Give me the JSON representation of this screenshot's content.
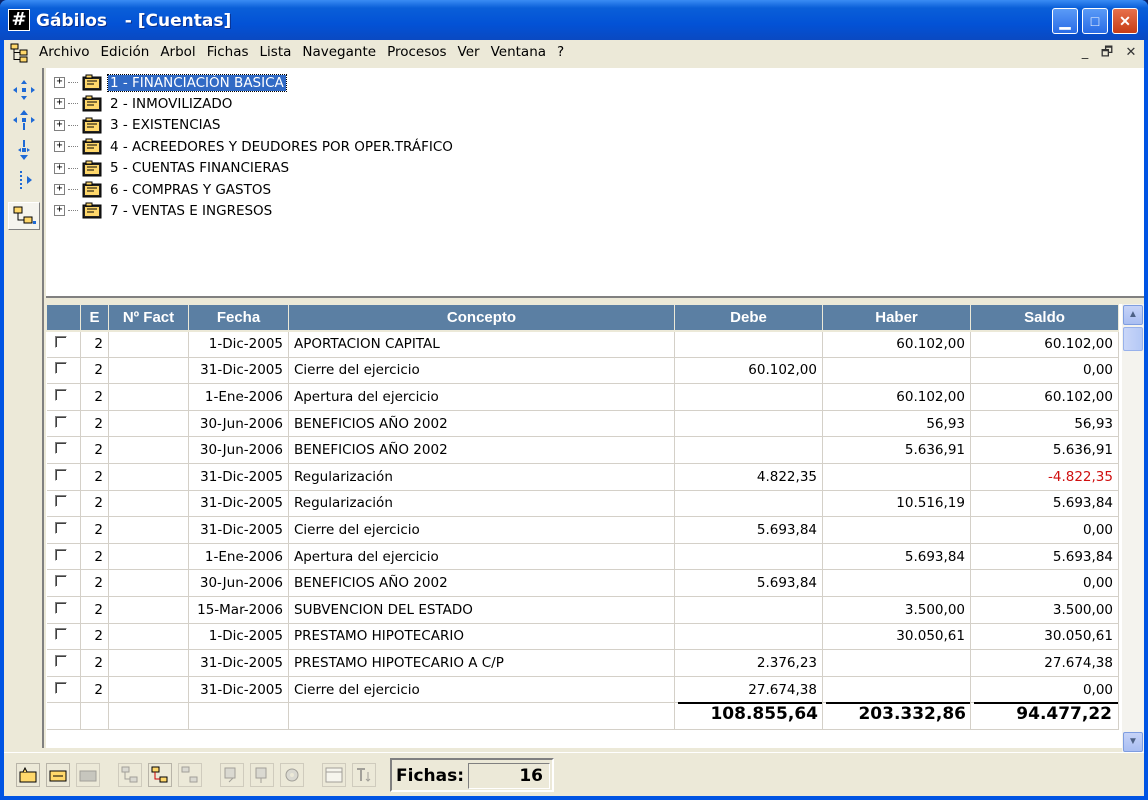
{
  "window": {
    "app_name": "Gábilos",
    "doc_title": " - [Cuentas]",
    "app_icon_glyph": "#",
    "minimize_glyph": "▁",
    "maximize_glyph": "□",
    "close_glyph": "✕"
  },
  "menu": {
    "items": [
      "Archivo",
      "Edición",
      "Arbol",
      "Fichas",
      "Lista",
      "Navegante",
      "Procesos",
      "Ver",
      "Ventana",
      "?"
    ],
    "mdi_minimize": "_",
    "mdi_restore": "🗗",
    "mdi_close": "✕"
  },
  "tree": {
    "expander": "+",
    "items": [
      {
        "label": "1 - FINANCIACIÓN BASICA",
        "selected": true
      },
      {
        "label": "2 - INMOVILIZADO",
        "selected": false
      },
      {
        "label": "3 - EXISTENCIAS",
        "selected": false
      },
      {
        "label": "4 - ACREEDORES Y DEUDORES POR OPER.TRÁFICO",
        "selected": false
      },
      {
        "label": "5 - CUENTAS FINANCIERAS",
        "selected": false
      },
      {
        "label": "6 - COMPRAS Y GASTOS",
        "selected": false
      },
      {
        "label": "7 - VENTAS E INGRESOS",
        "selected": false
      }
    ]
  },
  "grid": {
    "columns": [
      "",
      "E",
      "Nº Fact",
      "Fecha",
      "Concepto",
      "Debe",
      "Haber",
      "Saldo"
    ],
    "rows": [
      {
        "e": "2",
        "fact": "",
        "fecha": "1-Dic-2005",
        "concepto": "APORTACION CAPITAL",
        "debe": "",
        "haber": "60.102,00",
        "saldo": "60.102,00",
        "neg": false
      },
      {
        "e": "2",
        "fact": "",
        "fecha": "31-Dic-2005",
        "concepto": "Cierre del ejercicio",
        "debe": "60.102,00",
        "haber": "",
        "saldo": "0,00",
        "neg": false
      },
      {
        "e": "2",
        "fact": "",
        "fecha": "1-Ene-2006",
        "concepto": "Apertura del ejercicio",
        "debe": "",
        "haber": "60.102,00",
        "saldo": "60.102,00",
        "neg": false
      },
      {
        "e": "2",
        "fact": "",
        "fecha": "30-Jun-2006",
        "concepto": "BENEFICIOS AÑO 2002",
        "debe": "",
        "haber": "56,93",
        "saldo": "56,93",
        "neg": false
      },
      {
        "e": "2",
        "fact": "",
        "fecha": "30-Jun-2006",
        "concepto": "BENEFICIOS AÑO 2002",
        "debe": "",
        "haber": "5.636,91",
        "saldo": "5.636,91",
        "neg": false
      },
      {
        "e": "2",
        "fact": "",
        "fecha": "31-Dic-2005",
        "concepto": "Regularización",
        "debe": "4.822,35",
        "haber": "",
        "saldo": "-4.822,35",
        "neg": true
      },
      {
        "e": "2",
        "fact": "",
        "fecha": "31-Dic-2005",
        "concepto": "Regularización",
        "debe": "",
        "haber": "10.516,19",
        "saldo": "5.693,84",
        "neg": false
      },
      {
        "e": "2",
        "fact": "",
        "fecha": "31-Dic-2005",
        "concepto": "Cierre del ejercicio",
        "debe": "5.693,84",
        "haber": "",
        "saldo": "0,00",
        "neg": false
      },
      {
        "e": "2",
        "fact": "",
        "fecha": "1-Ene-2006",
        "concepto": "Apertura del ejercicio",
        "debe": "",
        "haber": "5.693,84",
        "saldo": "5.693,84",
        "neg": false
      },
      {
        "e": "2",
        "fact": "",
        "fecha": "30-Jun-2006",
        "concepto": "BENEFICIOS AÑO 2002",
        "debe": "5.693,84",
        "haber": "",
        "saldo": "0,00",
        "neg": false
      },
      {
        "e": "2",
        "fact": "",
        "fecha": "15-Mar-2006",
        "concepto": "SUBVENCION DEL ESTADO",
        "debe": "",
        "haber": "3.500,00",
        "saldo": "3.500,00",
        "neg": false
      },
      {
        "e": "2",
        "fact": "",
        "fecha": "1-Dic-2005",
        "concepto": "PRESTAMO HIPOTECARIO",
        "debe": "",
        "haber": "30.050,61",
        "saldo": "30.050,61",
        "neg": false
      },
      {
        "e": "2",
        "fact": "",
        "fecha": "31-Dic-2005",
        "concepto": "PRESTAMO HIPOTECARIO A C/P",
        "debe": "2.376,23",
        "haber": "",
        "saldo": "27.674,38",
        "neg": false
      },
      {
        "e": "2",
        "fact": "",
        "fecha": "31-Dic-2005",
        "concepto": "Cierre del ejercicio",
        "debe": "27.674,38",
        "haber": "",
        "saldo": "0,00",
        "neg": false
      }
    ],
    "totals": {
      "debe": "108.855,64",
      "haber": "203.332,86",
      "saldo": "94.477,22"
    }
  },
  "scrollbar": {
    "up_glyph": "▲",
    "down_glyph": "▼"
  },
  "status": {
    "fichas_label": "Fichas:",
    "fichas_value": "16"
  },
  "colors": {
    "header_bg": "#5b7fa3",
    "selection": "#316ac5",
    "negative": "#d01010",
    "titlebar": "#0a5fd8"
  }
}
